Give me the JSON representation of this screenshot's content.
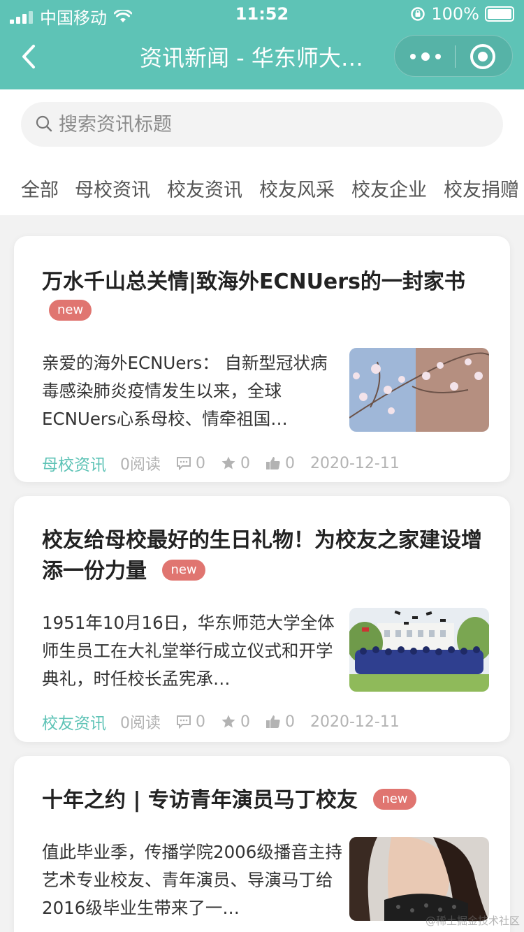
{
  "status": {
    "carrier": "中国移动",
    "time": "11:52",
    "battery": "100%"
  },
  "nav": {
    "title": "资讯新闻 - 华东师大…"
  },
  "search": {
    "placeholder": "搜索资讯标题"
  },
  "tabs": [
    "全部",
    "母校资讯",
    "校友资讯",
    "校友风采",
    "校友企业",
    "校友捐赠"
  ],
  "articles": [
    {
      "title": "万水千山总关情|致海外ECNUers的一封家书",
      "badge": "new",
      "excerpt": "亲爱的海外ECNUers： 自新型冠状病毒感染肺炎疫情发生以来，全球ECNUers心系母校、情牵祖国…",
      "category": "母校资讯",
      "reads": "0阅读",
      "comments": "0",
      "stars": "0",
      "likes": "0",
      "date": "2020-12-11"
    },
    {
      "title": "校友给母校最好的生日礼物！为校友之家建设增添一份力量",
      "badge": "new",
      "excerpt": "1951年10月16日，华东师范大学全体师生员工在大礼堂举行成立仪式和开学典礼，时任校长孟宪承…",
      "category": "校友资讯",
      "reads": "0阅读",
      "comments": "0",
      "stars": "0",
      "likes": "0",
      "date": "2020-12-11"
    },
    {
      "title": "十年之约 | 专访青年演员马丁校友",
      "badge": "new",
      "excerpt": "值此毕业季，传播学院2006级播音主持艺术专业校友、青年演员、导演马丁给2016级毕业生带来了一…"
    }
  ],
  "watermark": "@稀土掘金技术社区",
  "colors": {
    "accent": "#5ec3b6",
    "badge": "#e07570",
    "background": "#f2f2f2"
  }
}
